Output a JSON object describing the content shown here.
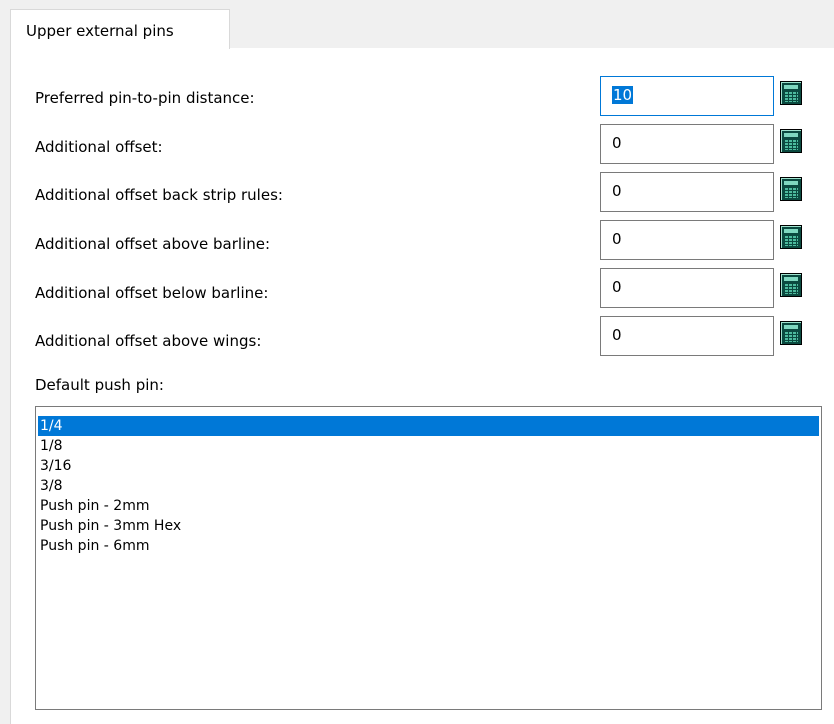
{
  "tab": {
    "label": "Upper external pins"
  },
  "fields": [
    {
      "label": "Preferred pin-to-pin distance:",
      "value": "10"
    },
    {
      "label": "Additional offset:",
      "value": "0"
    },
    {
      "label": "Additional offset back strip rules:",
      "value": "0"
    },
    {
      "label": "Additional offset above barline:",
      "value": "0"
    },
    {
      "label": "Additional offset below barline:",
      "value": "0"
    },
    {
      "label": "Additional offset above wings:",
      "value": "0"
    }
  ],
  "calculator_icon": "calculator-icon",
  "push_pin": {
    "label": "Default push pin:",
    "selected": "1/4",
    "options": [
      "1/4",
      "1/8",
      "3/16",
      "3/8",
      "Push pin - 2mm",
      "Push pin - 3mm Hex",
      "Push pin - 6mm"
    ]
  },
  "colors": {
    "selection": "#0078d7",
    "calculator": "#0b4a40"
  }
}
